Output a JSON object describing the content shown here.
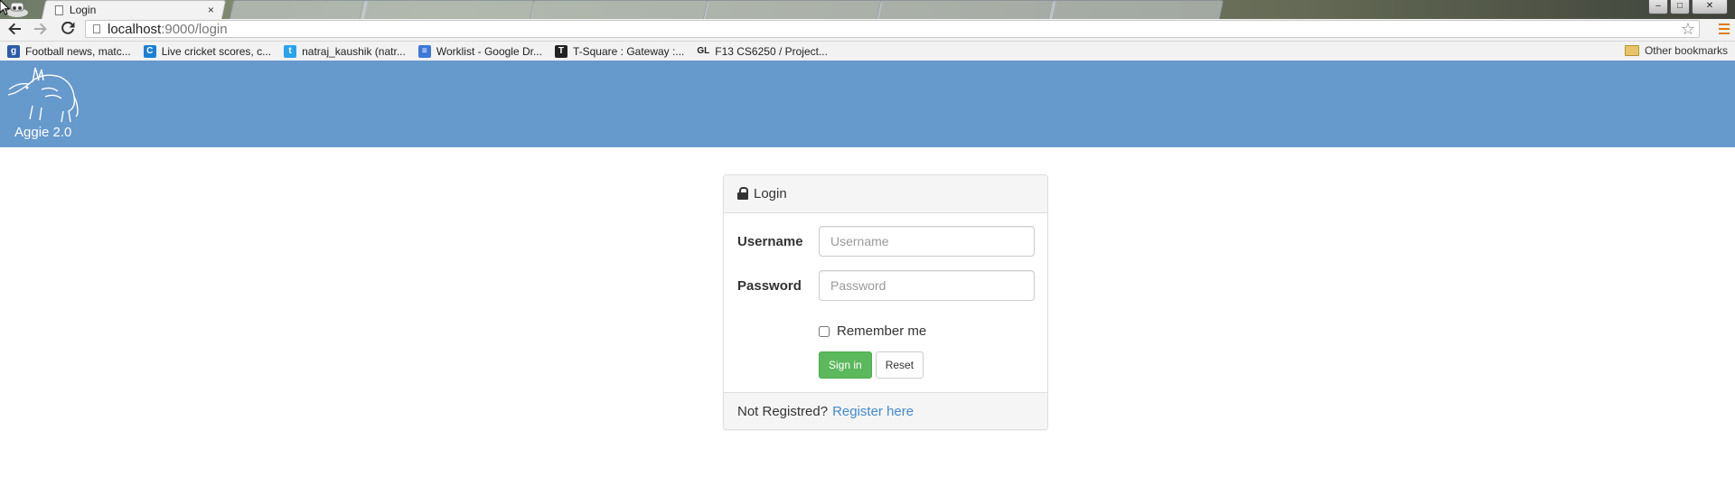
{
  "browser": {
    "active_tab": {
      "title": "Login",
      "close": "×"
    },
    "url": {
      "host": "localhost",
      "rest": ":9000/login"
    },
    "window_controls": {
      "minimize": "–",
      "maximize": "□",
      "close": "✕"
    },
    "bookmarks": [
      {
        "label": "Football news, matc...",
        "icon": "goal-icon",
        "color": "#2a5ca8",
        "glyph": "g"
      },
      {
        "label": "Live cricket scores, c...",
        "icon": "cricinfo-icon",
        "color": "#1b7fd6",
        "glyph": "C"
      },
      {
        "label": "natraj_kaushik (natr...",
        "icon": "twitter-icon",
        "color": "#2aa3ef",
        "glyph": "t"
      },
      {
        "label": "Worklist - Google Dr...",
        "icon": "google-docs-icon",
        "color": "#3d78d8",
        "glyph": "≡"
      },
      {
        "label": "T-Square : Gateway :...",
        "icon": "tsquare-icon",
        "color": "#222222",
        "glyph": "T"
      },
      {
        "label": "F13 CS6250 / Project...",
        "icon": "gitlab-icon",
        "color": "#f2f2f2",
        "glyph": "GL"
      }
    ],
    "other_bookmarks": "Other bookmarks"
  },
  "app": {
    "brand": "Aggie 2.0",
    "header_color": "#6699cc"
  },
  "login": {
    "heading": "Login",
    "username_label": "Username",
    "username_placeholder": "Username",
    "username_value": "",
    "password_label": "Password",
    "password_placeholder": "Password",
    "password_value": "",
    "remember_label": "Remember me",
    "remember_checked": false,
    "signin_label": "Sign in",
    "reset_label": "Reset",
    "footer_text": "Not Registred?",
    "register_link": "Register here",
    "colors": {
      "success": "#5cb85c",
      "link": "#428bca"
    }
  }
}
